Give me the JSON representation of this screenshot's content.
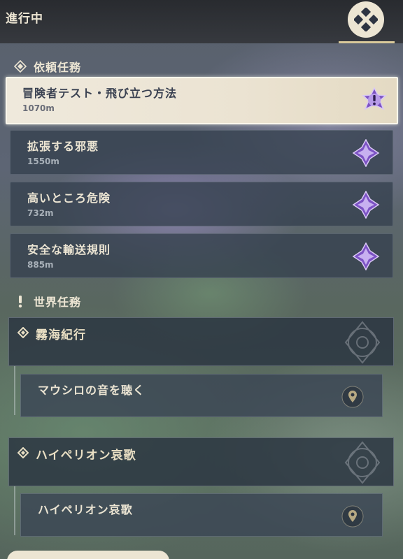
{
  "header": {
    "title": "進行中",
    "menu_icon": "quest-category-icon"
  },
  "request_section": {
    "label": "依頼任務",
    "icon": "request-quest-diamond-icon",
    "quests": [
      {
        "name": "冒険者テスト・飛び立つ方法",
        "distance": "1070m",
        "selected": true,
        "icon": "quest-marker-exclamation-icon"
      },
      {
        "name": "拡張する邪悪",
        "distance": "1550m",
        "selected": false,
        "icon": "quest-marker-star-icon"
      },
      {
        "name": "高いところ危険",
        "distance": "732m",
        "selected": false,
        "icon": "quest-marker-star-icon"
      },
      {
        "name": "安全な輸送規則",
        "distance": "885m",
        "selected": false,
        "icon": "quest-marker-star-icon"
      }
    ]
  },
  "world_section": {
    "label": "世界任務",
    "icon": "exclamation-icon",
    "chains": [
      {
        "title": "霧海紀行",
        "subquest": "マウシロの音を聴く"
      },
      {
        "title": "ハイペリオン哀歌",
        "subquest": "ハイペリオン哀歌"
      }
    ]
  },
  "colors": {
    "text_light": "#ece5d3",
    "selected_bg": "#efe9dc",
    "card_bg": "#34404e",
    "marker_purple": "#9b6fd8",
    "accent_gold": "#d9c99a"
  }
}
